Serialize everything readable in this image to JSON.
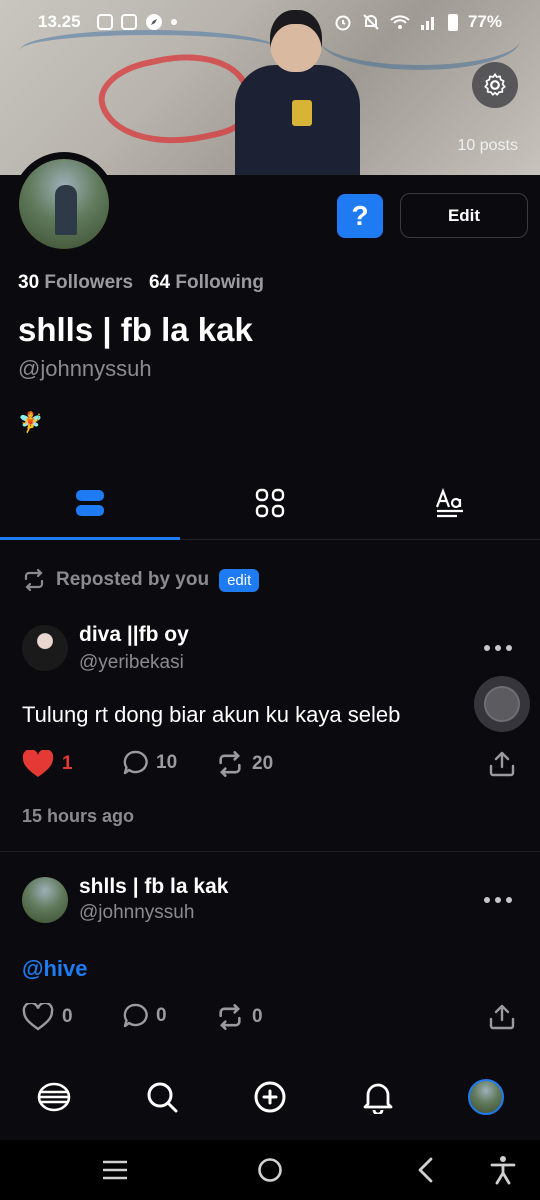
{
  "status_bar": {
    "time": "13.25",
    "battery": "77%"
  },
  "header": {
    "posts_count": "10 posts"
  },
  "profile": {
    "followers_count": "30",
    "followers_label": "Followers",
    "following_count": "64",
    "following_label": "Following",
    "display_name": "shlls | fb la kak",
    "handle": "@johnnyssuh",
    "bio_emoji": "🧚",
    "help_label": "?",
    "edit_label": "Edit"
  },
  "tabs": [
    {
      "name": "posts",
      "icon": "feed-icon",
      "active": true
    },
    {
      "name": "grid",
      "icon": "grid-icon",
      "active": false
    },
    {
      "name": "text",
      "icon": "text-icon",
      "active": false
    }
  ],
  "feed": {
    "posts": [
      {
        "repost_label": "Reposted by you",
        "edit_tag": "edit",
        "author_name": "diva ||fb oy",
        "author_handle": "@yeribekasi",
        "text": "Tulung rt dong biar akun ku kaya seleb",
        "likes": "1",
        "comments": "10",
        "reposts": "20",
        "liked": true,
        "timestamp": "15 hours ago"
      },
      {
        "author_name": "shlls | fb la kak",
        "author_handle": "@johnnyssuh",
        "mention": "@hive",
        "likes": "0",
        "comments": "0",
        "reposts": "0",
        "liked": false
      }
    ]
  },
  "bottom_nav": [
    "home-logo-icon",
    "search-icon",
    "create-icon",
    "notifications-icon",
    "profile-avatar"
  ],
  "colors": {
    "accent": "#1f7bf2",
    "like": "#e53935",
    "background": "#0b0b0f"
  }
}
